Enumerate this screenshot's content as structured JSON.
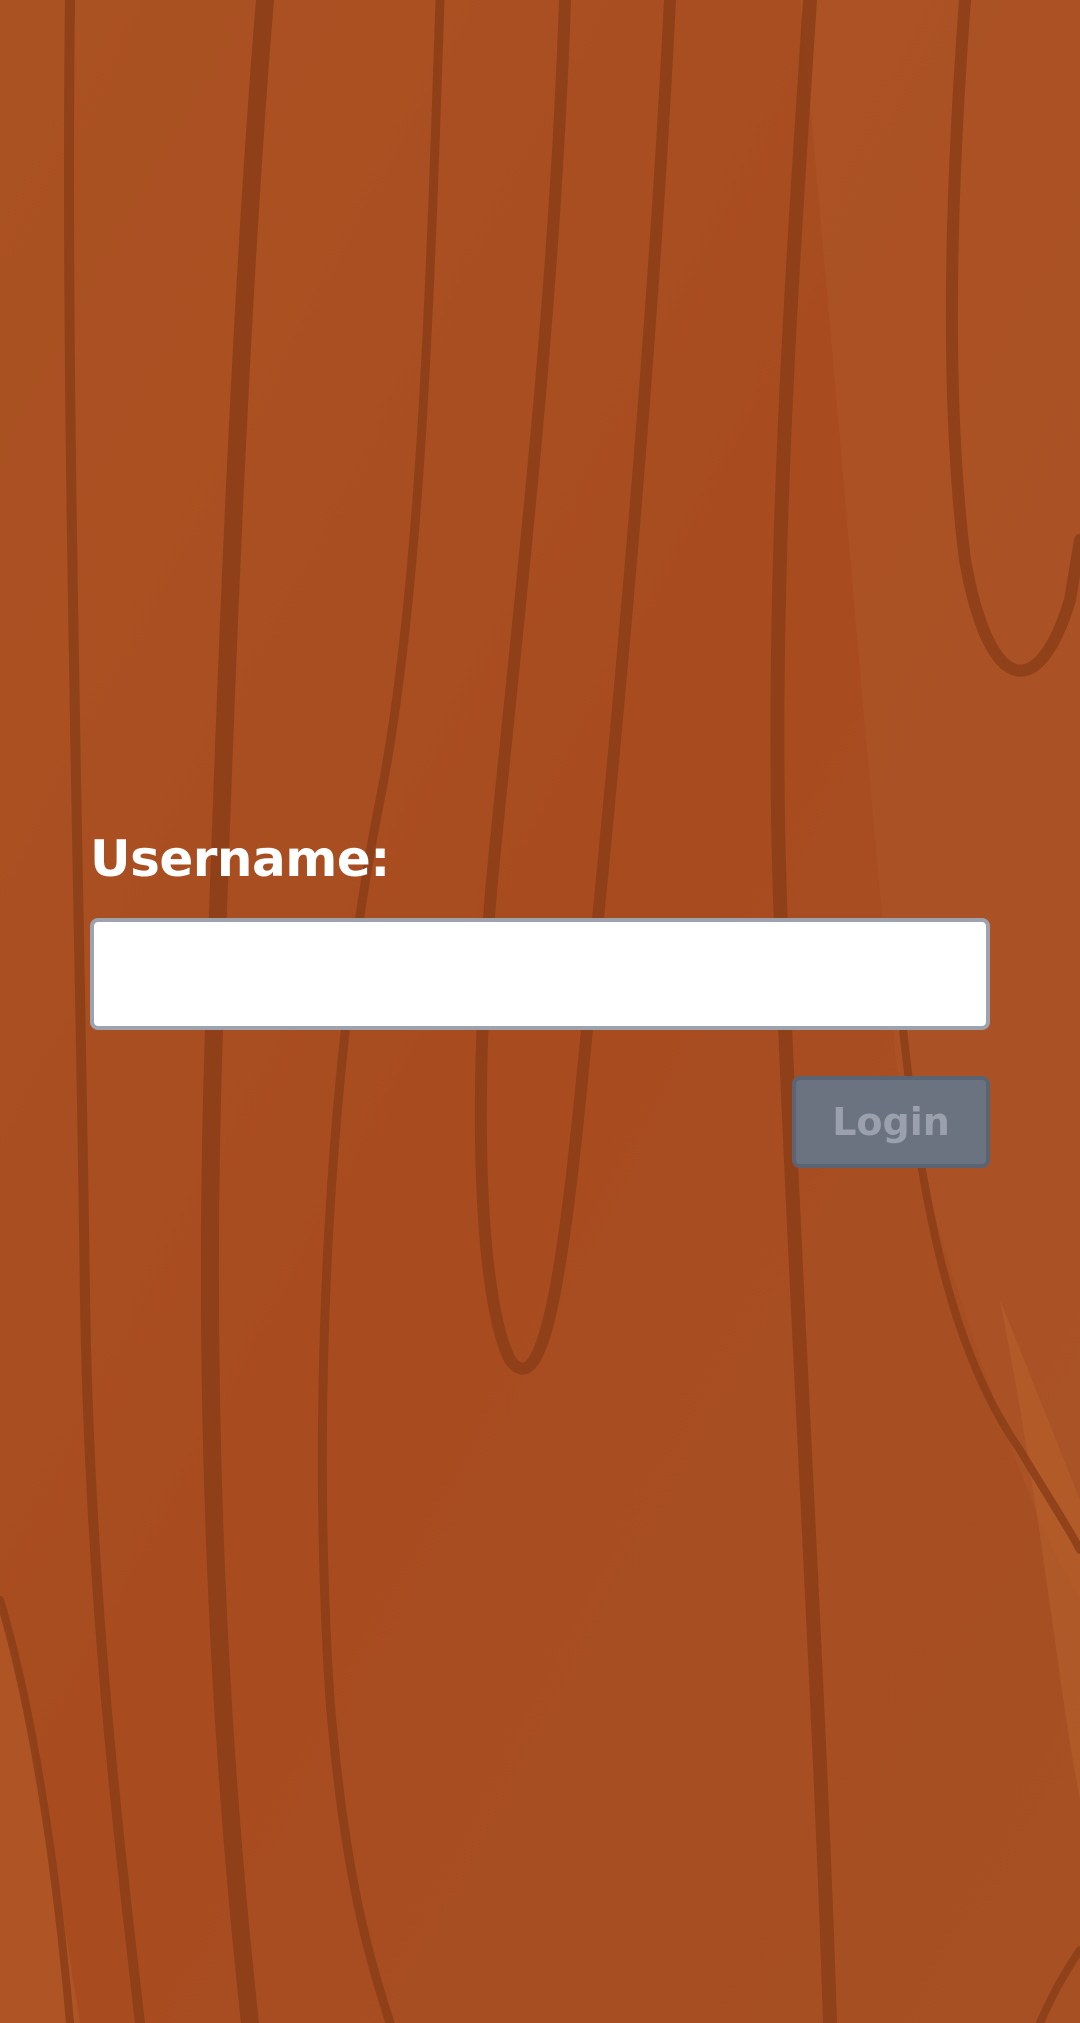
{
  "login": {
    "username_label": "Username:",
    "username_value": "",
    "login_button_label": "Login"
  },
  "colors": {
    "background": "#a84d20",
    "grain": "#8a3d18",
    "label_text": "#ffffff",
    "button_bg": "#6b7280",
    "button_text": "#9aa1ad",
    "input_border": "#9ca3af"
  }
}
